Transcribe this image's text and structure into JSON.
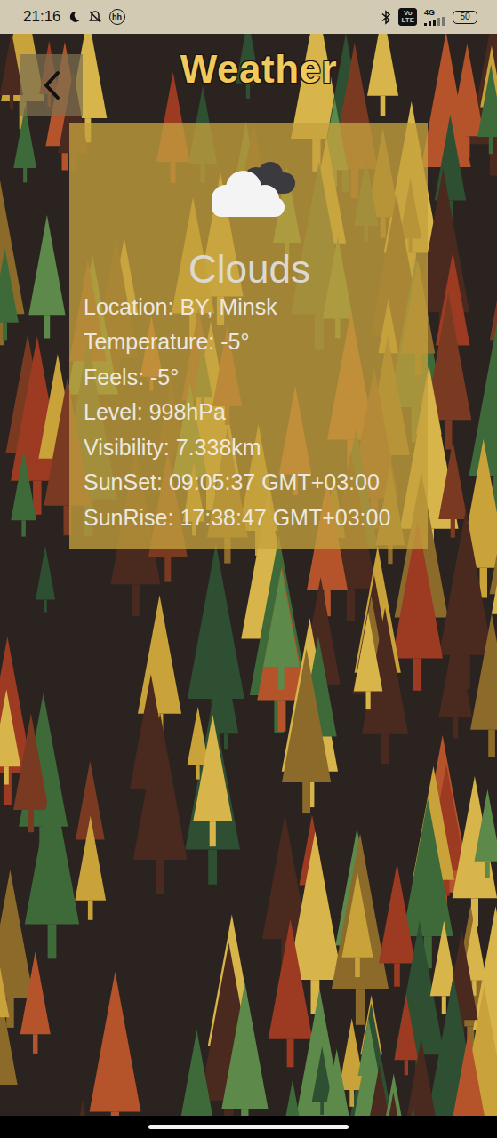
{
  "status_bar": {
    "time": "21:16",
    "hh": "hh",
    "volte_top": "Vo",
    "volte_bottom": "LTE",
    "network": "4G",
    "battery": "50"
  },
  "header": {
    "title": "Weather"
  },
  "weather": {
    "condition": "Clouds",
    "details": [
      "Location: BY, Minsk",
      "Temperature: -5°",
      "Feels: -5°",
      "Level: 998hPa",
      "Visibility: 7.338km",
      "SunSet: 09:05:37 GMT+03:00",
      "SunRise: 17:38:47 GMT+03:00"
    ]
  }
}
